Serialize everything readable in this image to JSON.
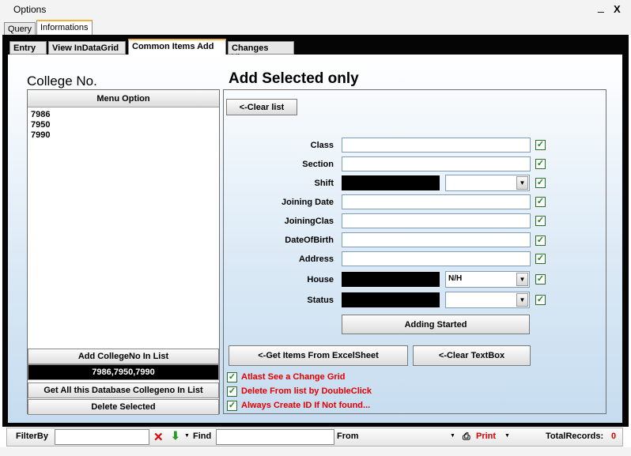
{
  "window": {
    "title": "Options",
    "minimize": "_",
    "close": "X"
  },
  "outer_tabs": [
    "Query",
    "Informations"
  ],
  "inner_tabs": [
    "Entry",
    "View InDataGrid",
    "Common Items Add",
    "Changes View"
  ],
  "left_panel": {
    "title": "College No.",
    "menu_header": "Menu Option",
    "items": [
      "7986",
      "7950",
      "7990"
    ],
    "add_button": "Add CollegeNo In List",
    "joined_value": "7986,7950,7990",
    "get_all_button": "Get All this Database Collegeno In List",
    "delete_button": "Delete Selected"
  },
  "right_panel": {
    "title": "Add Selected only",
    "clear_list_button": "<-Clear list",
    "fields": {
      "class": "Class",
      "section": "Section",
      "shift": "Shift",
      "joining_date": "Joining Date",
      "joining_clas": "JoiningClas",
      "date_of_birth": "DateOfBirth",
      "address": "Address",
      "house": "House",
      "status": "Status"
    },
    "house_value": "N/H",
    "adding_button": "Adding Started",
    "excel_button": "<-Get Items From ExcelSheet",
    "clear_textbox_button": "<-Clear TextBox",
    "options": [
      "Atlast See a Change Grid",
      "Delete From list by DoubleClick",
      "Always Create ID If Not found..."
    ],
    "checkmark": "✓"
  },
  "bottom_bar": {
    "filter_label": "FilterBy",
    "find_label": "Find",
    "from_label": "From",
    "print_label": "Print",
    "total_label": "TotalRecords:",
    "total_value": "0"
  }
}
